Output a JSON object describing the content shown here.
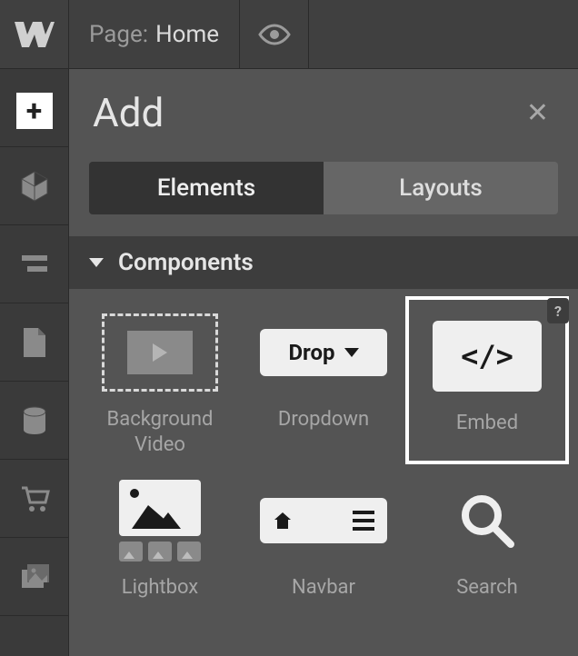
{
  "topbar": {
    "page_prefix": "Page:",
    "page_name": "Home"
  },
  "panel": {
    "title": "Add",
    "tabs": [
      "Elements",
      "Layouts"
    ],
    "active_tab_index": 0,
    "section_title": "Components",
    "help_badge": "?"
  },
  "dropdown_text": "Drop",
  "embed_glyph": "</>",
  "elements": {
    "bg_video": "Background Video",
    "dropdown": "Dropdown",
    "embed": "Embed",
    "lightbox": "Lightbox",
    "navbar": "Navbar",
    "search": "Search"
  }
}
